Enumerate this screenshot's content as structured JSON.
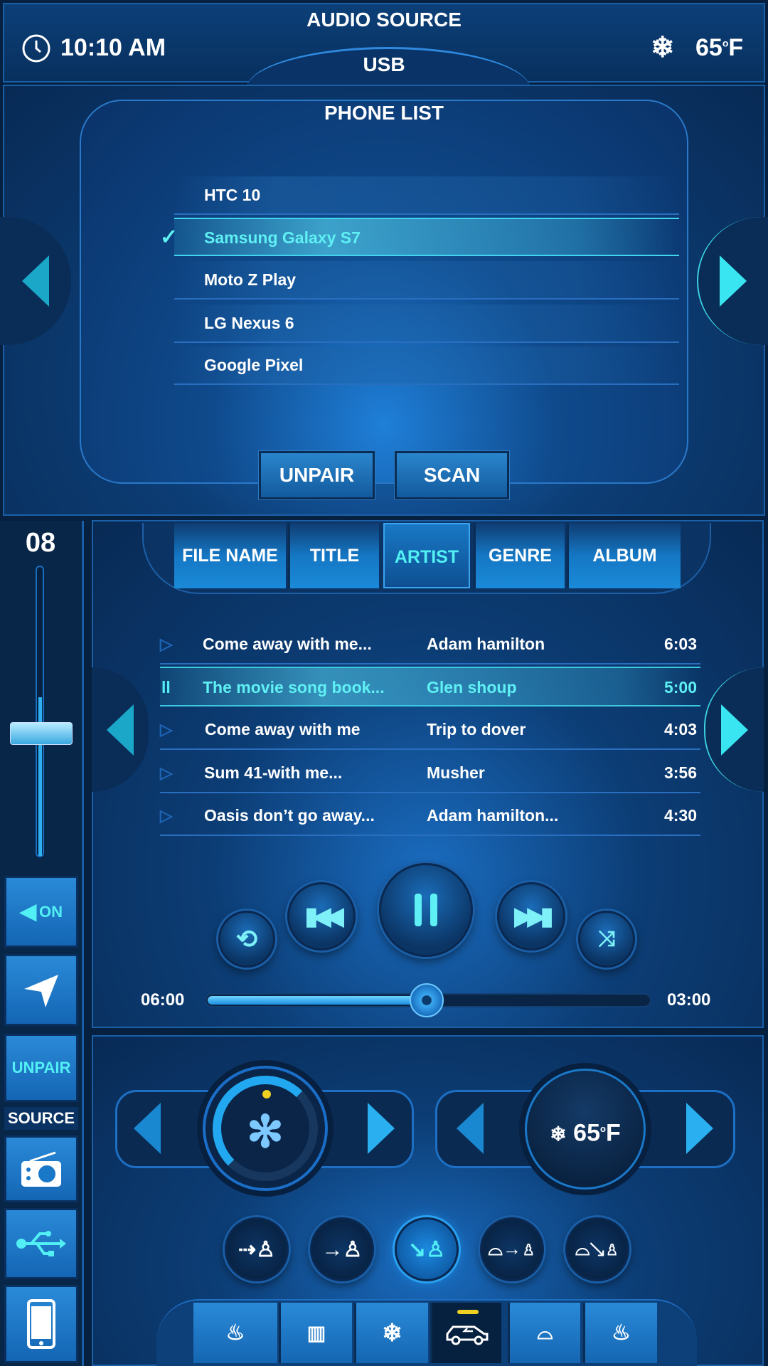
{
  "header": {
    "title": "AUDIO SOURCE",
    "source": "USB",
    "time": "10:10 AM",
    "temperature": "65",
    "temp_degree": "o",
    "temp_unit": "F"
  },
  "phone_list": {
    "title": "PHONE LIST",
    "items": [
      {
        "name": "HTC 10",
        "selected": false
      },
      {
        "name": "Samsung Galaxy S7",
        "selected": true
      },
      {
        "name": "Moto Z Play",
        "selected": false
      },
      {
        "name": "LG Nexus 6",
        "selected": false
      },
      {
        "name": "Google Pixel",
        "selected": false
      }
    ],
    "unpair_label": "UNPAIR",
    "scan_label": "SCAN"
  },
  "volume": {
    "value": "08",
    "level_fraction": 0.55
  },
  "sidebar": {
    "mute_label": "ON",
    "unpair_label": "UNPAIR",
    "source_label": "SOURCE"
  },
  "media": {
    "tabs": [
      "FILE NAME",
      "TITLE",
      "ARTIST",
      "GENRE",
      "ALBUM"
    ],
    "active_tab": "ARTIST",
    "songs": [
      {
        "title": "Come away with me...",
        "artist": "Adam hamilton",
        "duration": "6:03",
        "playing": false
      },
      {
        "title": "The movie song book...",
        "artist": "Glen shoup",
        "duration": "5:00",
        "playing": true
      },
      {
        "title": "Come away with me",
        "artist": "Trip to dover",
        "duration": "4:03",
        "playing": false
      },
      {
        "title": "Sum 41-with me...",
        "artist": "Musher",
        "duration": "3:56",
        "playing": false
      },
      {
        "title": "Oasis don’t go away...",
        "artist": "Adam hamilton...",
        "duration": "4:30",
        "playing": false
      }
    ],
    "elapsed": "06:00",
    "remaining": "03:00",
    "progress_fraction": 0.5
  },
  "climate": {
    "temperature": "65",
    "temp_degree": "o",
    "temp_unit": "F",
    "fan_level_fraction": 0.4,
    "active_airflow": "feet",
    "active_bottom_tab": "recirculation"
  },
  "colors": {
    "accent": "#52f0f4",
    "background": "#06203f",
    "tab": "#1a8ad8",
    "indicator": "#f0d020"
  }
}
